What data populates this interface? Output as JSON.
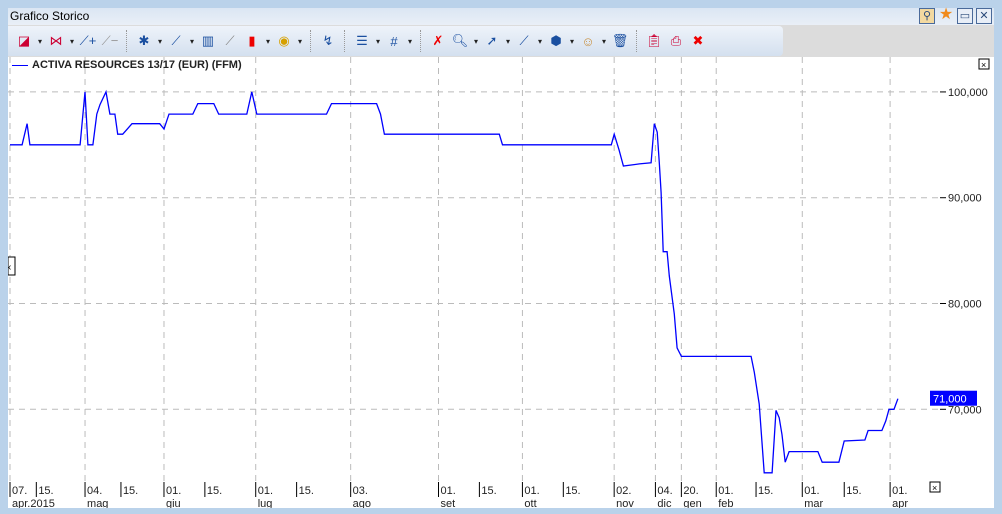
{
  "window": {
    "title": "Grafico Storico",
    "controls": [
      "favorites-icon",
      "star-icon",
      "maximize-icon",
      "close-icon"
    ]
  },
  "toolbar": {
    "groups": [
      [
        "chart-type-icon",
        "compare-icon",
        "add-indicator-icon",
        "remove-indicator-icon"
      ],
      [
        "new-study-icon",
        "trendline-icon",
        "volume-icon",
        "overlay-icon",
        "candlestick-icon",
        "currency-icon"
      ],
      [
        "signal-icon"
      ],
      [
        "lines-icon",
        "grid-icon"
      ],
      [
        "delete-drawing-icon",
        "zoom-icon",
        "cursor-icon",
        "line-tool-icon",
        "fill-icon",
        "face-icon",
        "trash-icon"
      ],
      [
        "clipboard-icon",
        "print-icon",
        "export-icon"
      ]
    ]
  },
  "legend": {
    "label": "ACTIVA RESOURCES 13/17 (EUR) (FFM)",
    "color": "#0000ff"
  },
  "chart_data": {
    "type": "line",
    "title": "ACTIVA RESOURCES 13/17 (EUR) (FFM)",
    "x_unit": "session index",
    "xlim": [
      0,
      250
    ],
    "ylim": [
      63.6,
      101.6
    ],
    "yticks": [
      "100,000",
      "90,000",
      "80,000",
      "70,000"
    ],
    "ytick_values": [
      100,
      90,
      80,
      70
    ],
    "last_value_label": "71,000",
    "last_value": 71,
    "colors": {
      "line": "#0000ff",
      "last_badge": "#0000ff"
    },
    "xticks": [
      {
        "x": 0,
        "day": "07.",
        "month": "apr.2015",
        "major": true
      },
      {
        "x": 7.4,
        "day": "15.",
        "month": "",
        "major": false
      },
      {
        "x": 21.1,
        "day": "04.",
        "month": "mag",
        "major": true
      },
      {
        "x": 31.2,
        "day": "15.",
        "month": "",
        "major": false
      },
      {
        "x": 43.3,
        "day": "01.",
        "month": "giu",
        "major": true
      },
      {
        "x": 54.8,
        "day": "15.",
        "month": "",
        "major": false
      },
      {
        "x": 69.1,
        "day": "01.",
        "month": "lug",
        "major": true
      },
      {
        "x": 80.6,
        "day": "15.",
        "month": "",
        "major": false
      },
      {
        "x": 95.8,
        "day": "03.",
        "month": "ago",
        "major": true
      },
      {
        "x": 120.5,
        "day": "01.",
        "month": "set",
        "major": true
      },
      {
        "x": 132.0,
        "day": "15.",
        "month": "",
        "major": false
      },
      {
        "x": 144.1,
        "day": "01.",
        "month": "ott",
        "major": true
      },
      {
        "x": 155.6,
        "day": "15.",
        "month": "",
        "major": false
      },
      {
        "x": 169.9,
        "day": "02.",
        "month": "nov",
        "major": true
      },
      {
        "x": 181.5,
        "day": "04.",
        "month": "dic",
        "major": true
      },
      {
        "x": 188.8,
        "day": "20.",
        "month": "gen",
        "major": true
      },
      {
        "x": 198.6,
        "day": "01.",
        "month": "feb",
        "major": true
      },
      {
        "x": 209.8,
        "day": "15.",
        "month": "",
        "major": false
      },
      {
        "x": 222.8,
        "day": "01.",
        "month": "mar",
        "major": true
      },
      {
        "x": 234.6,
        "day": "15.",
        "month": "",
        "major": false
      },
      {
        "x": 247.5,
        "day": "01.",
        "month": "apr",
        "major": true
      }
    ],
    "points": [
      [
        0,
        95
      ],
      [
        3.4,
        95
      ],
      [
        4.8,
        97
      ],
      [
        5.6,
        95
      ],
      [
        19.7,
        95
      ],
      [
        21.1,
        100
      ],
      [
        21.9,
        95
      ],
      [
        23.3,
        95
      ],
      [
        24.4,
        97.9
      ],
      [
        25.3,
        98.8
      ],
      [
        27.0,
        100
      ],
      [
        28.1,
        97.9
      ],
      [
        29.5,
        97.9
      ],
      [
        30.3,
        96
      ],
      [
        31.7,
        96
      ],
      [
        34.3,
        97
      ],
      [
        42.1,
        97
      ],
      [
        43.3,
        96.5
      ],
      [
        44.7,
        97.9
      ],
      [
        51.4,
        97.9
      ],
      [
        52.8,
        98.9
      ],
      [
        57.3,
        98.9
      ],
      [
        58.7,
        97.9
      ],
      [
        66.6,
        97.9
      ],
      [
        68.0,
        100
      ],
      [
        69.4,
        97.9
      ],
      [
        89.0,
        97.9
      ],
      [
        90.4,
        98.9
      ],
      [
        103.1,
        98.9
      ],
      [
        104.2,
        97.9
      ],
      [
        105.3,
        96
      ],
      [
        137.6,
        96
      ],
      [
        138.5,
        95
      ],
      [
        169.1,
        95
      ],
      [
        169.9,
        96
      ],
      [
        171.3,
        94.5
      ],
      [
        172.5,
        93
      ],
      [
        177.0,
        93.2
      ],
      [
        180.3,
        93.3
      ],
      [
        181.2,
        97
      ],
      [
        182.0,
        96.2
      ],
      [
        182.6,
        93.3
      ],
      [
        183.1,
        90.5
      ],
      [
        183.7,
        84.9
      ],
      [
        184.8,
        84.9
      ],
      [
        185.4,
        82.6
      ],
      [
        186.8,
        79
      ],
      [
        187.6,
        75.8
      ],
      [
        188.8,
        75
      ],
      [
        208.4,
        75
      ],
      [
        209.3,
        73.5
      ],
      [
        210.7,
        70.5
      ],
      [
        212.1,
        64
      ],
      [
        214.3,
        64
      ],
      [
        215.4,
        69.9
      ],
      [
        216.3,
        69.2
      ],
      [
        217.1,
        67.6
      ],
      [
        218.0,
        65
      ],
      [
        219.1,
        66
      ],
      [
        227.2,
        66
      ],
      [
        228.4,
        65
      ],
      [
        233.1,
        65
      ],
      [
        234.6,
        67
      ],
      [
        240.4,
        67.1
      ],
      [
        241.3,
        68
      ],
      [
        245.2,
        68
      ],
      [
        246.3,
        68.9
      ],
      [
        247.2,
        70
      ],
      [
        248.6,
        70
      ],
      [
        249.7,
        71
      ]
    ]
  }
}
